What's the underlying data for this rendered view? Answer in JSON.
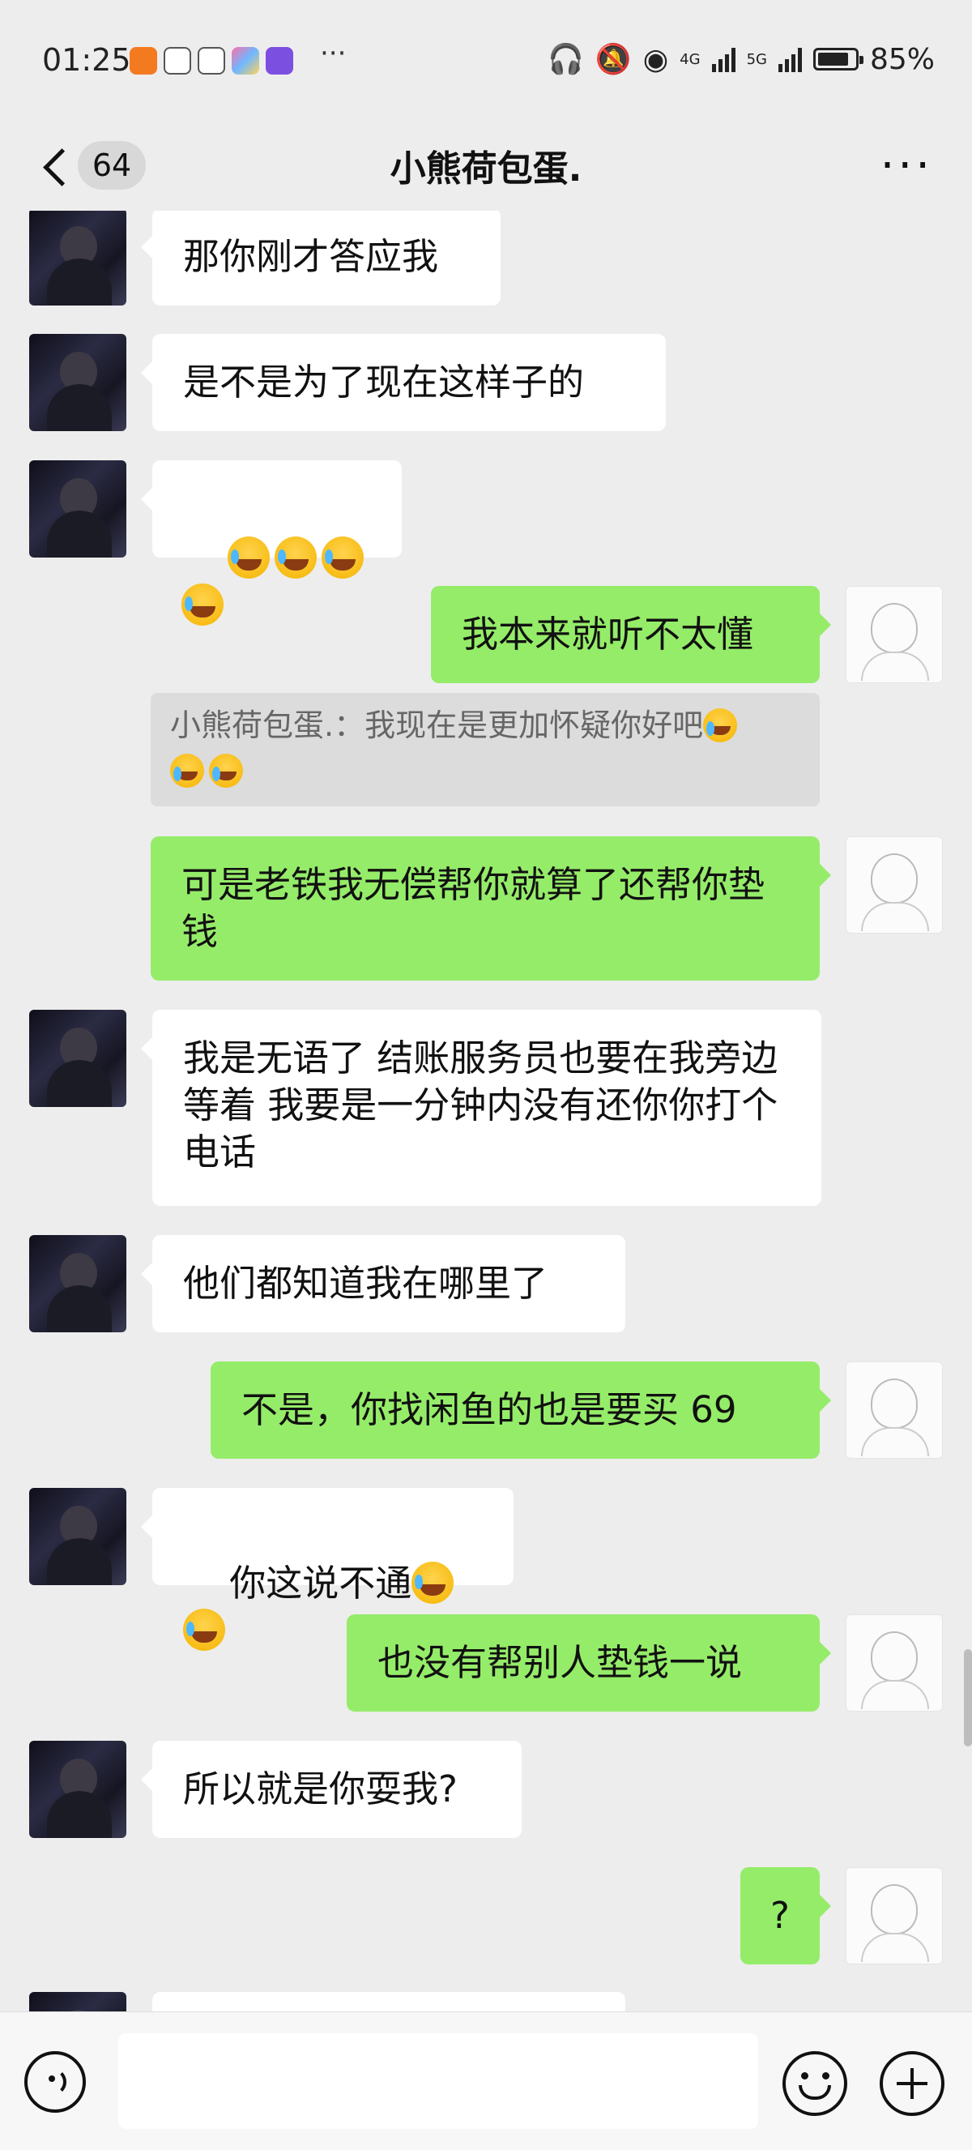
{
  "status_bar": {
    "time": "01:25",
    "network_1": "4G",
    "network_2": "5G",
    "battery": "85%",
    "battery_level": 0.85,
    "app_icons": [
      "taobao-icon",
      "baidu-paw-icon",
      "baidu-paw-icon",
      "app-icon",
      "tieba-icon"
    ]
  },
  "header": {
    "unread_count": "64",
    "title": "小熊荷包蛋.",
    "more_label": "···"
  },
  "messages": [
    {
      "side": "in",
      "text": "那你刚才答应我"
    },
    {
      "side": "in",
      "text": "是不是为了现在这样子的"
    },
    {
      "side": "in",
      "emoji_count": 4,
      "emoji": "crying-laughing-emoji"
    },
    {
      "side": "out",
      "text": "我本来就听不太懂"
    },
    {
      "side": "quote",
      "text": "小熊荷包蛋.：我现在是更加怀疑你好吧",
      "emoji_count": 3
    },
    {
      "side": "out",
      "text": "可是老铁我无偿帮你就算了还帮你垫钱"
    },
    {
      "side": "in",
      "text": "我是无语了 结账服务员也要在我旁边等着 我要是一分钟内没有还你你打个电话"
    },
    {
      "side": "in",
      "text": "他们都知道我在哪里了"
    },
    {
      "side": "out",
      "text": "不是，你找闲鱼的也是要买 69"
    },
    {
      "side": "in",
      "text": "你这说不通",
      "emoji_count": 2
    },
    {
      "side": "out",
      "text": "也没有帮别人垫钱一说"
    },
    {
      "side": "in",
      "text": "所以就是你耍我?"
    },
    {
      "side": "out",
      "text": "?"
    }
  ],
  "input": {
    "placeholder": ""
  },
  "colors": {
    "background": "#ededed",
    "outgoing_bubble": "#95ec69",
    "incoming_bubble": "#ffffff",
    "quote_bg": "#dcdcdc"
  }
}
